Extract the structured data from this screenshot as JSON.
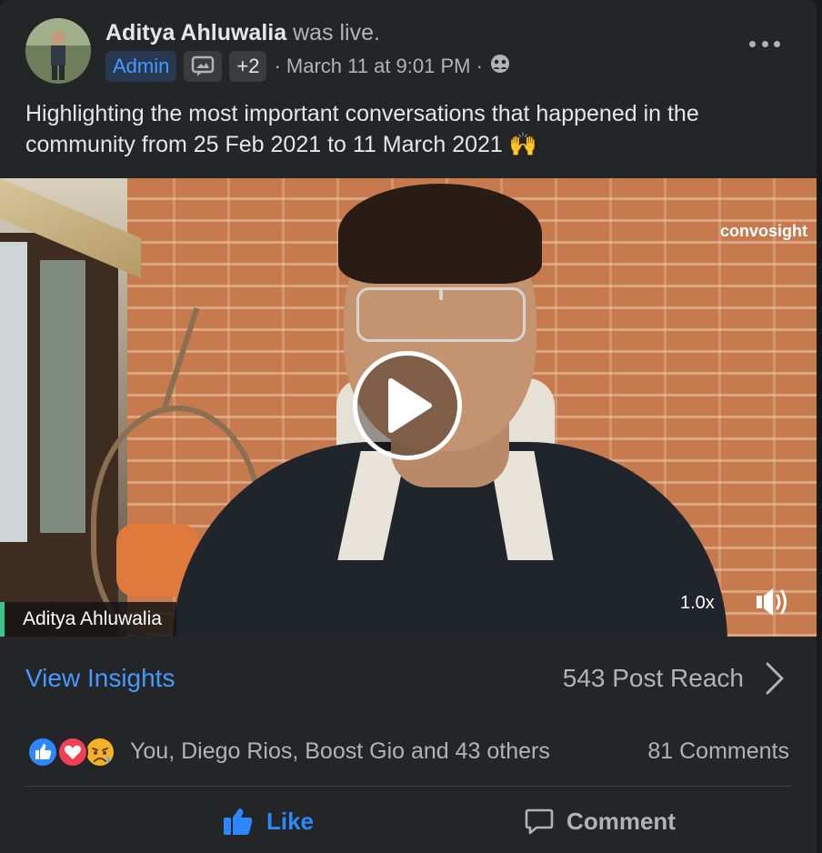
{
  "post": {
    "author": "Aditya Ahluwalia",
    "author_suffix": "was live.",
    "badge_admin": "Admin",
    "badge_more": "+2",
    "timestamp": "· March 11 at 9:01 PM ·",
    "privacy_icon": "group-privacy-icon",
    "text": "Highlighting the most important conversations that happened in the community from 25 Feb 2021 to 11 March 2021 🙌"
  },
  "video": {
    "watermark": "convosight",
    "name_tag": "Aditya Ahluwalia",
    "speed": "1.0x",
    "play_icon": "play-icon",
    "volume_icon": "volume-icon"
  },
  "insights": {
    "link": "View Insights",
    "reach": "543 Post Reach"
  },
  "reactions": {
    "icons": [
      "like-reaction-icon",
      "love-reaction-icon",
      "sad-reaction-icon"
    ],
    "names": "You, Diego Rios, Boost Gio and 43 others",
    "comments": "81 Comments"
  },
  "actions": {
    "like": "Like",
    "comment": "Comment"
  },
  "colors": {
    "background": "#242526",
    "link_blue": "#4599ff",
    "like_blue": "#2d88ff",
    "secondary_text": "#b0b3b8"
  }
}
